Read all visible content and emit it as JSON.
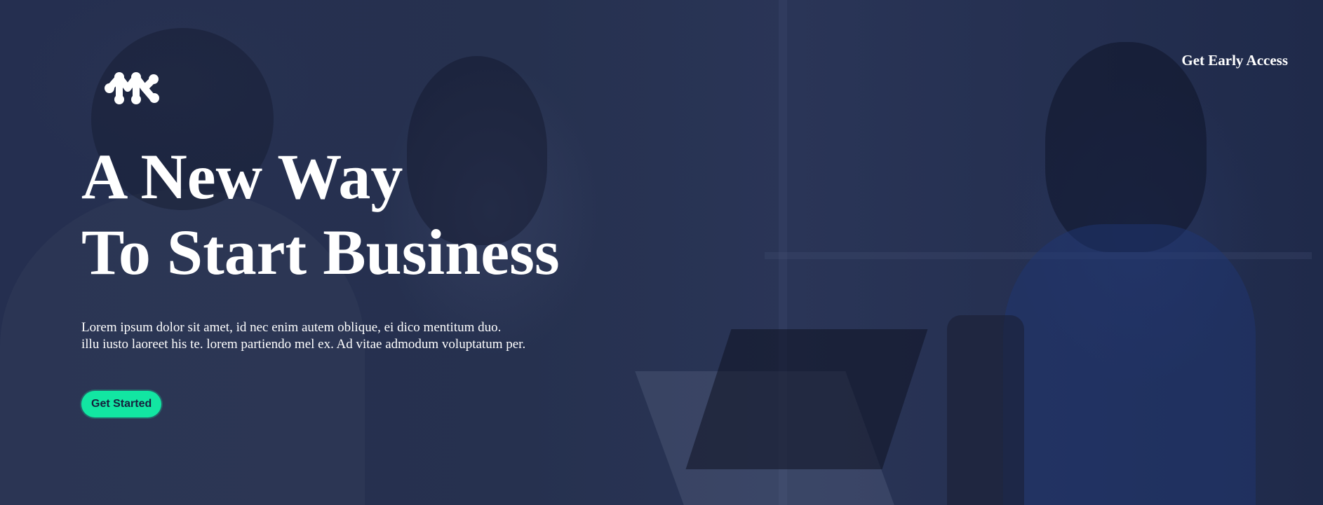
{
  "header": {
    "logo_icon": "molecule-logo-icon",
    "cta_label": "Get Early Access"
  },
  "hero": {
    "headline_line1": "A New Way",
    "headline_line2": "To Start Business",
    "lede_line1": "Lorem ipsum dolor sit amet, id nec enim autem oblique, ei dico mentitum duo.",
    "lede_line2": "illu iusto laoreet his te. lorem partiendo mel ex. Ad vitae admodum voluptatum per.",
    "button_label": "Get Started"
  },
  "colors": {
    "overlay": "#232e4e",
    "text": "#ffffff",
    "accent": "#12e6a2",
    "button_text": "#14213d"
  }
}
